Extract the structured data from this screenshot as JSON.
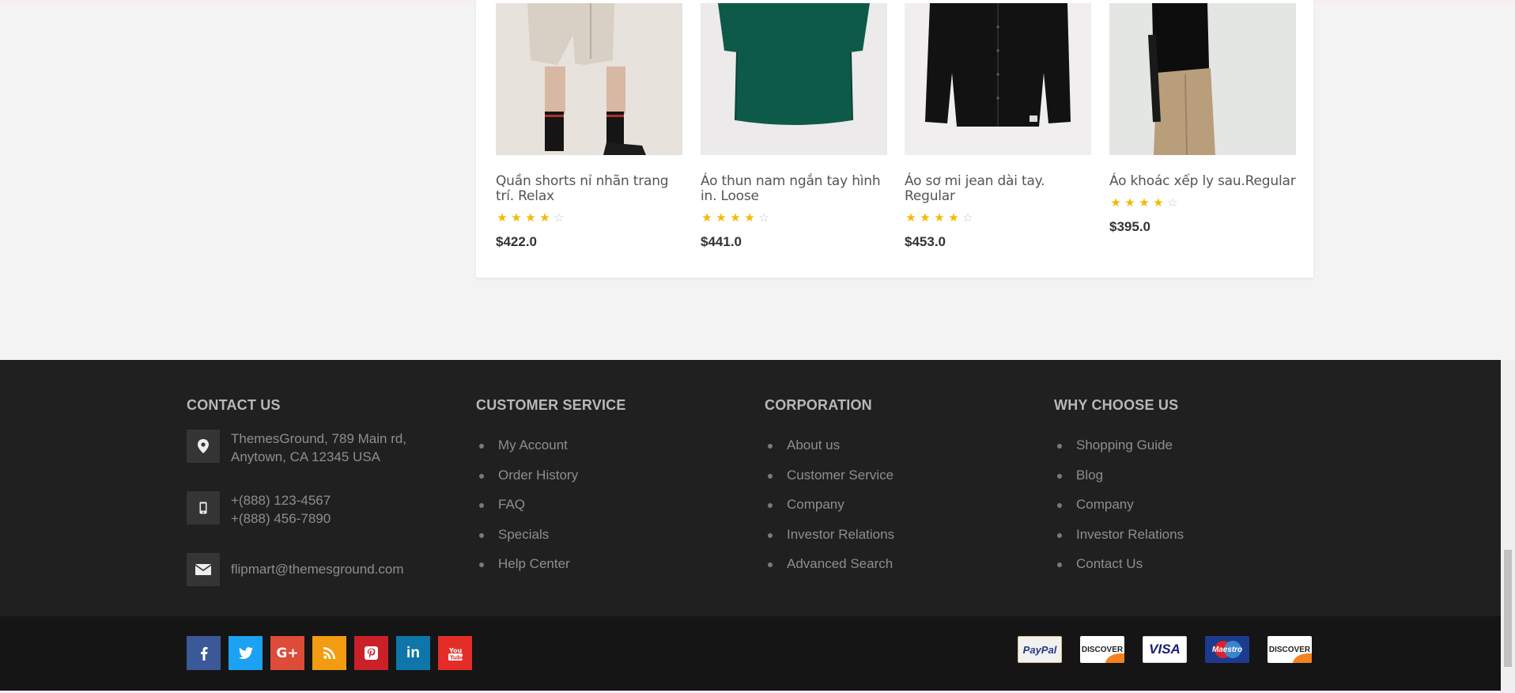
{
  "products": [
    {
      "name": "Quần shorts nỉ nhãn trang trí. Relax",
      "rating": 4,
      "price": "$422.0"
    },
    {
      "name": "Áo thun nam ngắn tay hình in. Loose",
      "rating": 4,
      "price": "$441.0"
    },
    {
      "name": "Áo sơ mi jean dài tay. Regular",
      "rating": 4,
      "price": "$453.0"
    },
    {
      "name": "Áo khoác xếp ly sau.Regular",
      "rating": 4,
      "price": "$395.0"
    }
  ],
  "footer": {
    "contact": {
      "title": "CONTACT US",
      "address": "ThemesGround, 789 Main rd, Anytown, CA 12345 USA",
      "phone1": "+(888) 123-4567",
      "phone2": "+(888) 456-7890",
      "email": "flipmart@themesground.com"
    },
    "customer_service": {
      "title": "CUSTOMER SERVICE",
      "links": [
        "My Account",
        "Order History",
        "FAQ",
        "Specials",
        "Help Center"
      ]
    },
    "corporation": {
      "title": "CORPORATION",
      "links": [
        "About us",
        "Customer Service",
        "Company",
        "Investor Relations",
        "Advanced Search"
      ]
    },
    "why_choose_us": {
      "title": "WHY CHOOSE US",
      "links": [
        "Shopping Guide",
        "Blog",
        "Company",
        "Investor Relations",
        "Contact Us"
      ]
    },
    "social": [
      {
        "icon": "facebook-icon",
        "glyph": "f",
        "color": "#3b5998"
      },
      {
        "icon": "twitter-icon",
        "glyph": "t",
        "color": "#1da1f2"
      },
      {
        "icon": "google-plus-icon",
        "glyph": "G+",
        "color": "#dd4b39"
      },
      {
        "icon": "rss-icon",
        "glyph": "rss",
        "color": "#f39c12"
      },
      {
        "icon": "pinterest-icon",
        "glyph": "P",
        "color": "#cb2027"
      },
      {
        "icon": "linkedin-icon",
        "glyph": "in",
        "color": "#0e76a8"
      },
      {
        "icon": "youtube-icon",
        "glyph": "yt",
        "color": "#e52d27"
      }
    ],
    "payments": [
      {
        "name": "PayPal",
        "icon": "paypal-icon"
      },
      {
        "name": "DISCOVER",
        "icon": "discover-icon"
      },
      {
        "name": "VISA",
        "icon": "visa-icon"
      },
      {
        "name": "Maestro",
        "icon": "maestro-icon"
      },
      {
        "name": "DISCOVER",
        "icon": "discover-icon"
      }
    ]
  }
}
